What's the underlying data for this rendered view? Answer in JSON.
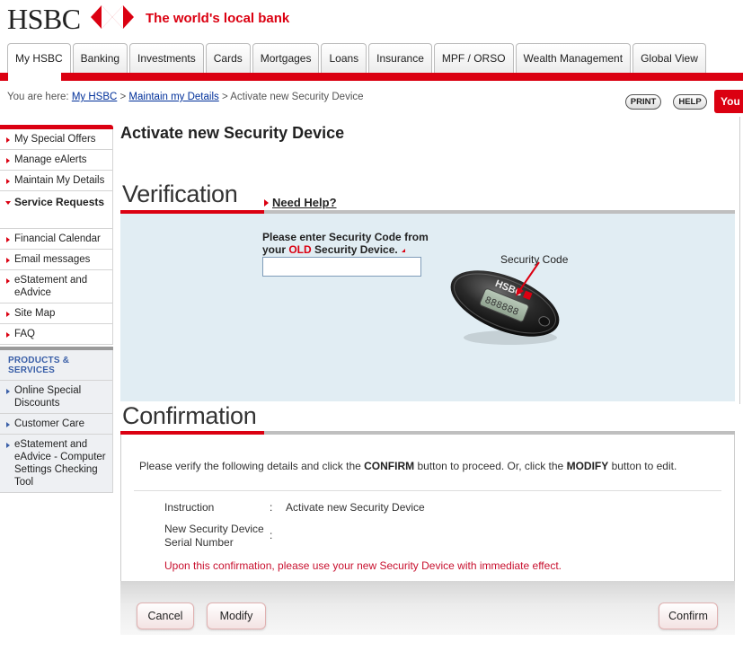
{
  "brand": {
    "logo_text": "HSBC",
    "tagline": "The world's local bank",
    "brand_red": "#db0011"
  },
  "tabs": [
    {
      "label": "My HSBC",
      "active": true
    },
    {
      "label": "Banking"
    },
    {
      "label": "Investments"
    },
    {
      "label": "Cards"
    },
    {
      "label": "Mortgages"
    },
    {
      "label": "Loans"
    },
    {
      "label": "Insurance"
    },
    {
      "label": "MPF / ORSO"
    },
    {
      "label": "Wealth Management"
    },
    {
      "label": "Global View"
    }
  ],
  "breadcrumb": {
    "prefix": "You are here: ",
    "links": [
      "My HSBC",
      "Maintain my Details"
    ],
    "separator": " > ",
    "current": "Activate new Security Device"
  },
  "utility": {
    "print_label": "PRINT",
    "help_label": "HELP",
    "you_label": "You"
  },
  "sidebar": {
    "items": [
      {
        "label": "My Special Offers"
      },
      {
        "label": "Manage eAlerts"
      },
      {
        "label": "Maintain My Details"
      },
      {
        "label": "Service Requests",
        "expanded": true
      },
      {
        "label": "Financial Calendar"
      },
      {
        "label": "Email messages"
      },
      {
        "label": "eStatement and eAdvice"
      },
      {
        "label": "Site Map"
      },
      {
        "label": "FAQ"
      }
    ]
  },
  "products": {
    "heading": "PRODUCTS & SERVICES",
    "items": [
      {
        "label": "Online Special Discounts"
      },
      {
        "label": "Customer Care"
      },
      {
        "label": "eStatement and eAdvice - Computer Settings Checking Tool"
      }
    ]
  },
  "main": {
    "page_title": "Activate new Security Device",
    "verification": {
      "title": "Verification",
      "need_help": "Need Help?",
      "prompt_line1": "Please enter Security Code from",
      "prompt_your": "your ",
      "prompt_old": "OLD",
      "prompt_rest": " Security Device.",
      "input_value": "",
      "device_label": "Security Code",
      "device_brand": "HSBC",
      "device_display": "888888"
    },
    "confirmation": {
      "title": "Confirmation",
      "text_pre": "Please verify the following details and click the ",
      "text_confirm": "CONFIRM",
      "text_mid": " button to proceed. Or, click the ",
      "text_modify": "MODIFY",
      "text_post": " button to edit.",
      "rows": [
        {
          "label": "Instruction",
          "colon": ":",
          "value": "Activate new Security Device"
        },
        {
          "label_line1": "New Security Device",
          "label_line2": "Serial Number",
          "colon": ":",
          "value": ""
        }
      ],
      "warning": "Upon this confirmation, please use your new Security Device with immediate effect."
    },
    "buttons": {
      "cancel": "Cancel",
      "modify": "Modify",
      "confirm": "Confirm"
    }
  }
}
